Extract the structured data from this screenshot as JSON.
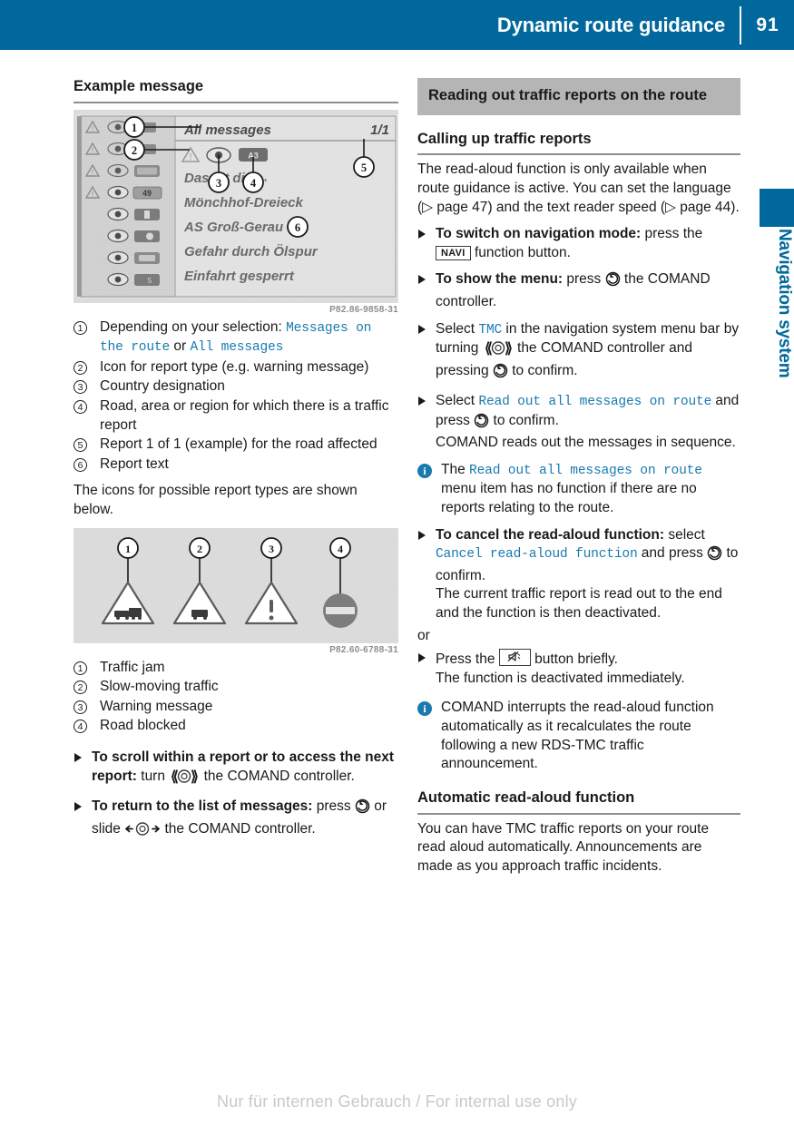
{
  "header": {
    "title": "Dynamic route guidance",
    "page_number": "91"
  },
  "side_tab": {
    "label": "Navigation system",
    "accent_color": "#00689c"
  },
  "left_column": {
    "heading": "Example message",
    "figure_message": {
      "caption_id": "P82.86-9858-31",
      "title": "All messages",
      "counter": "1/1",
      "lines": [
        "Das ist die →",
        "Mönchhof-Dreieck",
        "AS Groß-Gerau",
        "Gefahr durch Ölspur",
        "Einfahrt gesperrt"
      ],
      "road_badges": [
        "",
        "",
        "",
        "49",
        "",
        "",
        "",
        ""
      ],
      "callouts": [
        "1",
        "2",
        "3",
        "4",
        "5",
        "6"
      ]
    },
    "legend_message": [
      {
        "num": "1",
        "pre": "Depending on your selection: ",
        "mono1": "Messages on the route",
        "mid": " or ",
        "mono2": "All messages",
        "post": ""
      },
      {
        "num": "2",
        "pre": "Icon for report type (e.g. warning message)",
        "mono1": "",
        "mid": "",
        "mono2": "",
        "post": ""
      },
      {
        "num": "3",
        "pre": "Country designation",
        "mono1": "",
        "mid": "",
        "mono2": "",
        "post": ""
      },
      {
        "num": "4",
        "pre": "Road, area or region for which there is a traffic report",
        "mono1": "",
        "mid": "",
        "mono2": "",
        "post": ""
      },
      {
        "num": "5",
        "pre": "Report 1 of 1 (example) for the road affected",
        "mono1": "",
        "mid": "",
        "mono2": "",
        "post": ""
      },
      {
        "num": "6",
        "pre": "Report text",
        "mono1": "",
        "mid": "",
        "mono2": "",
        "post": ""
      }
    ],
    "icons_intro": "The icons for possible report types are shown below.",
    "figure_icons": {
      "caption_id": "P82.60-6788-31",
      "callouts": [
        "1",
        "2",
        "3",
        "4"
      ]
    },
    "legend_icons": [
      {
        "num": "1",
        "text": "Traffic jam"
      },
      {
        "num": "2",
        "text": "Slow-moving traffic"
      },
      {
        "num": "3",
        "text": "Warning message"
      },
      {
        "num": "4",
        "text": "Road blocked"
      }
    ],
    "steps": [
      {
        "bold": "To scroll within a report or to access the next report:",
        "after": " turn ",
        "glyph": "turn-controller-icon",
        "tail": " the COMAND controller."
      },
      {
        "bold": "To return to the list of messages:",
        "after": " press ",
        "glyph": "press-controller-icon",
        "tail": " or slide ",
        "glyph2": "slide-controller-icon",
        "tail2": " the COMAND controller."
      }
    ]
  },
  "right_column": {
    "gray_heading": "Reading out traffic reports on the route",
    "sub_heading_1": "Calling up traffic reports",
    "intro_paragraph": {
      "part1": "The read-aloud function is only available when route guidance is active. You can set the language (",
      "ref1": "▷ page 47",
      "part2": ") and the text reader speed (",
      "ref2": "▷ page 44",
      "part3": ")."
    },
    "steps": [
      {
        "bold": "To switch on navigation mode:",
        "after": " press the ",
        "button": "NAVI",
        "tail": " function button."
      },
      {
        "bold": "To show the menu:",
        "after": " press ",
        "glyph": "press-controller-icon",
        "tail": " the COMAND controller."
      },
      {
        "bold": "",
        "after": "Select ",
        "mono": "TMC",
        "mid": " in the navigation system menu bar by turning ",
        "glyph": "turn-controller-icon",
        "tail": " the COMAND controller and pressing ",
        "glyph2": "press-controller-icon",
        "tail2": " to confirm."
      },
      {
        "bold": "",
        "after": "Select ",
        "mono": "Read out all messages on route",
        "mid": " and press ",
        "glyph": "press-controller-icon",
        "tail": " to confirm.",
        "extra": "COMAND reads out the messages in sequence."
      }
    ],
    "note_1": {
      "pre": "The ",
      "mono": "Read out all messages on route",
      "post": " menu item has no function if there are no reports relating to the route."
    },
    "cancel_step": {
      "bold": "To cancel the read-aloud function:",
      "after": " select ",
      "mono": "Cancel read-aloud function",
      "mid": " and press ",
      "glyph": "press-controller-icon",
      "tail": " to confirm.",
      "extra": "The current traffic report is read out to the end and the function is then deactivated."
    },
    "or_label": "or",
    "mute_step": {
      "pre": "Press the ",
      "button": "mute-button-icon",
      "post": " button briefly.",
      "extra": "The function is deactivated immediately."
    },
    "note_2": "COMAND interrupts the read-aloud function automatically as it recalculates the route following a new RDS-TMC traffic announcement.",
    "sub_heading_2": "Automatic read-aloud function",
    "closing_paragraph": "You can have TMC traffic reports on your route read aloud automatically. Announcements are made as you approach traffic incidents."
  },
  "footer": {
    "text": "Nur für internen Gebrauch / For internal use only"
  }
}
